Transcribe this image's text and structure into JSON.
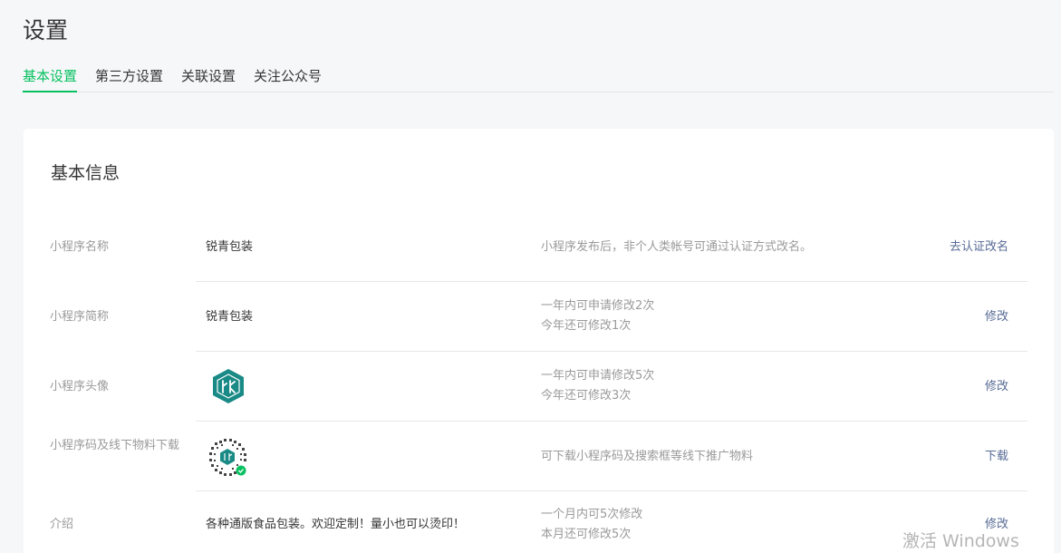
{
  "page": {
    "title": "设置"
  },
  "tabs": [
    {
      "label": "基本设置",
      "active": true
    },
    {
      "label": "第三方设置",
      "active": false
    },
    {
      "label": "关联设置",
      "active": false
    },
    {
      "label": "关注公众号",
      "active": false
    }
  ],
  "card": {
    "title": "基本信息",
    "rows": [
      {
        "label": "小程序名称",
        "value": "锐青包装",
        "desc": [
          "小程序发布后，非个人类帐号可通过认证方式改名。"
        ],
        "action": "去认证改名"
      },
      {
        "label": "小程序简称",
        "value": "锐青包装",
        "desc": [
          "一年内可申请修改2次",
          "今年还可修改1次"
        ],
        "action": "修改"
      },
      {
        "label": "小程序头像",
        "value_type": "avatar-image",
        "desc": [
          "一年内可申请修改5次",
          "今年还可修改3次"
        ],
        "action": "修改"
      },
      {
        "label": "小程序码及线下物料下载",
        "value_type": "qrcode-image",
        "desc": [
          "可下载小程序码及搜索框等线下推广物料"
        ],
        "action": "下载"
      },
      {
        "label": "介绍",
        "value": "各种通版食品包装。欢迎定制！量小也可以烫印！",
        "desc": [
          "一个月内可5次修改",
          "本月还可修改5次"
        ],
        "action": "修改"
      }
    ]
  },
  "colors": {
    "accent": "#07c160",
    "link": "#576b95",
    "avatar": "#1a8a86"
  },
  "watermark": "激活 Windows"
}
